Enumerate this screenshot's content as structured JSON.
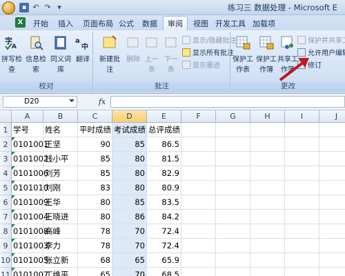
{
  "window": {
    "title": "练习三 数据处理 - Microsoft E"
  },
  "qat": {
    "save_icon": "save-icon",
    "undo": "↶",
    "redo": "↷"
  },
  "tabs": [
    "开始",
    "插入",
    "页面布局",
    "公式",
    "数据",
    "审阅",
    "视图",
    "开发工具",
    "加载项"
  ],
  "active_tab": "审阅",
  "ribbon": {
    "proofing": {
      "label": "校对",
      "buttons": [
        "拼写检查",
        "信息检索",
        "同义词库",
        "翻译"
      ]
    },
    "comments": {
      "label": "批注",
      "new_comment": "新建批注",
      "delete": "删除",
      "prev": "上一条",
      "next": "下一条",
      "show_hide": "显示/隐藏批注",
      "show_all": "显示所有批注",
      "show_ink": "显示墨迹"
    },
    "changes": {
      "label": "更改",
      "protect_sheet": "保护工作表",
      "protect_workbook": "保护工作簿",
      "share_workbook": "共享工作簿",
      "protect_share": "保护并共享工作",
      "allow_edit": "允许用户编辑区",
      "track_changes": "修订"
    }
  },
  "formula_bar": {
    "name_box": "D20",
    "fx": "fx",
    "formula": ""
  },
  "grid": {
    "columns": [
      "A",
      "B",
      "C",
      "D",
      "E",
      "F",
      "G",
      "H",
      "I",
      "J"
    ],
    "rows": [
      [
        "学号",
        "姓名",
        "平时成绩",
        "考试成绩",
        "总评成绩"
      ],
      [
        "0101001",
        "王坚",
        "90",
        "85",
        "86.5"
      ],
      [
        "0101002",
        "钱小平",
        "85",
        "80",
        "81.5"
      ],
      [
        "0101006",
        "刘芳",
        "85",
        "80",
        "82.9"
      ],
      [
        "0101010",
        "刘刚",
        "83",
        "80",
        "80.9"
      ],
      [
        "0101009",
        "王华",
        "80",
        "85",
        "83.5"
      ],
      [
        "0101004",
        "王晓进",
        "80",
        "86",
        "84.2"
      ],
      [
        "0101008",
        "高峰",
        "78",
        "70",
        "72.4"
      ],
      [
        "0101003",
        "李力",
        "78",
        "70",
        "72.4"
      ],
      [
        "0101005",
        "张立新",
        "68",
        "65",
        "65.9"
      ],
      [
        "0101007",
        "丁维平",
        "65",
        "70",
        "68.5"
      ]
    ],
    "row_numbers": [
      "1",
      "2",
      "3",
      "4",
      "5",
      "6",
      "7",
      "8",
      "9",
      "10",
      "11"
    ]
  },
  "colors": {
    "accent": "#1e7a3c",
    "selected_col": "#f8cf6b",
    "annotation": "#c0181d"
  }
}
